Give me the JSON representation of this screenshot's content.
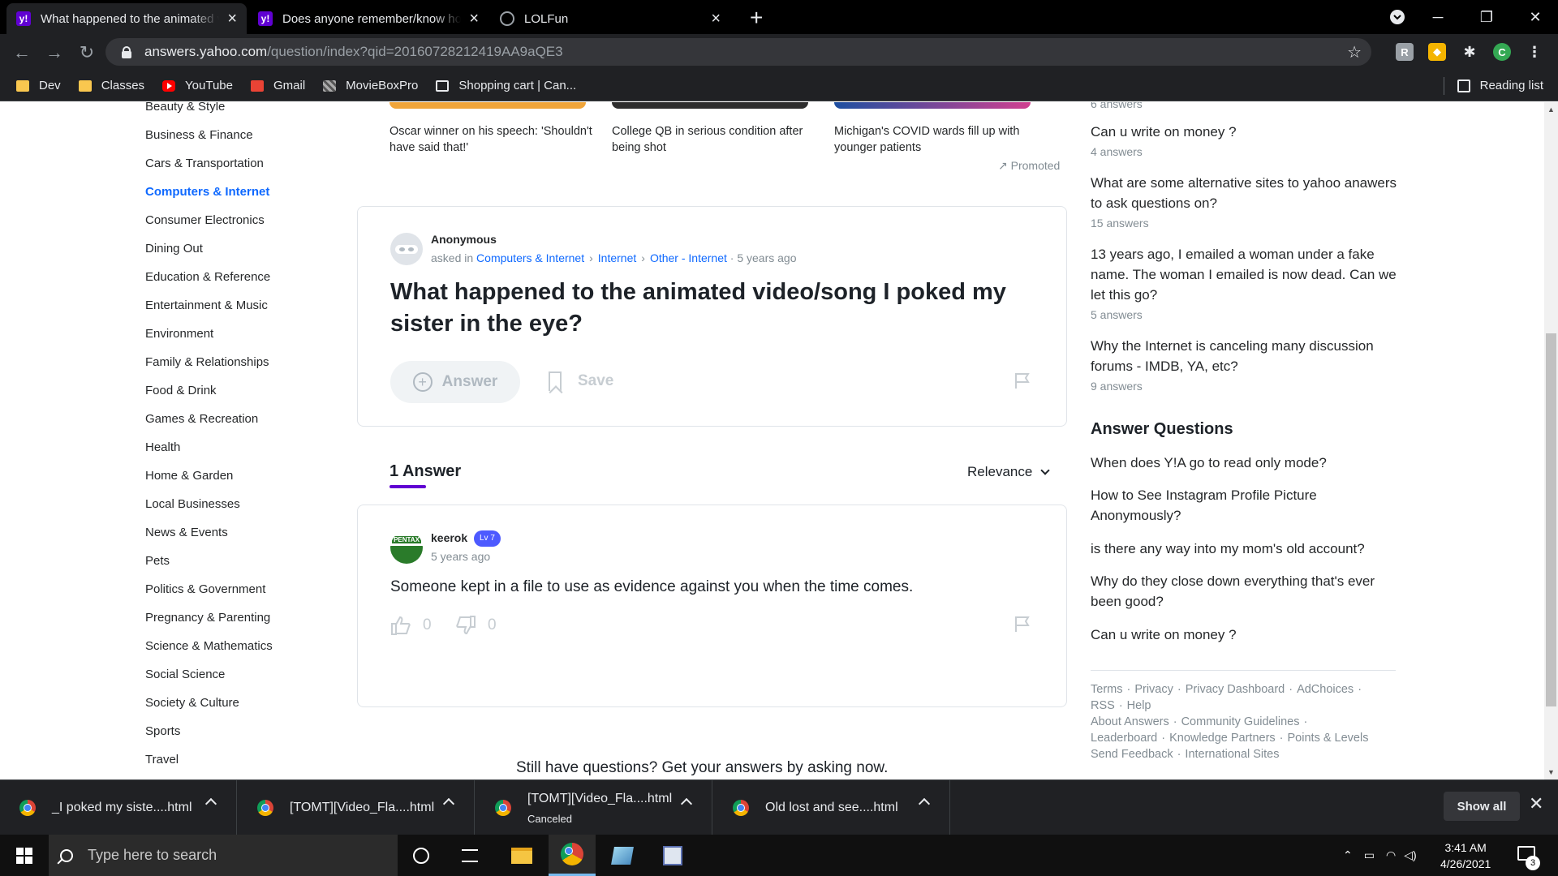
{
  "browser": {
    "tabs": [
      {
        "title": "What happened to the animated video/song I poked my sister in the eye? - Yahoo Answers",
        "favicon": "yahoo-icon",
        "active": true
      },
      {
        "title": "Does anyone remember/know how to find an old video?",
        "favicon": "yahoo-icon",
        "active": false
      },
      {
        "title": "LOLFun",
        "favicon": "globe-icon",
        "active": false
      }
    ],
    "url_host": "answers.yahoo.com",
    "url_path": "/question/index?qid=20160728212419AA9aQE3",
    "profile_initial": "C",
    "bookmarks": [
      {
        "label": "Dev",
        "icon": "folder-icon"
      },
      {
        "label": "Classes",
        "icon": "folder-icon"
      },
      {
        "label": "YouTube",
        "icon": "youtube-icon"
      },
      {
        "label": "Gmail",
        "icon": "gmail-icon"
      },
      {
        "label": "MovieBoxPro",
        "icon": "moviebox-icon"
      },
      {
        "label": "Shopping cart | Can...",
        "icon": "cart-icon"
      }
    ],
    "reading_list": "Reading list"
  },
  "sidebar": {
    "categories": [
      {
        "label": "Beauty & Style",
        "active": false
      },
      {
        "label": "Business & Finance",
        "active": false
      },
      {
        "label": "Cars & Transportation",
        "active": false
      },
      {
        "label": "Computers & Internet",
        "active": true
      },
      {
        "label": "Consumer Electronics",
        "active": false
      },
      {
        "label": "Dining Out",
        "active": false
      },
      {
        "label": "Education & Reference",
        "active": false
      },
      {
        "label": "Entertainment & Music",
        "active": false
      },
      {
        "label": "Environment",
        "active": false
      },
      {
        "label": "Family & Relationships",
        "active": false
      },
      {
        "label": "Food & Drink",
        "active": false
      },
      {
        "label": "Games & Recreation",
        "active": false
      },
      {
        "label": "Health",
        "active": false
      },
      {
        "label": "Home & Garden",
        "active": false
      },
      {
        "label": "Local Businesses",
        "active": false
      },
      {
        "label": "News & Events",
        "active": false
      },
      {
        "label": "Pets",
        "active": false
      },
      {
        "label": "Politics & Government",
        "active": false
      },
      {
        "label": "Pregnancy & Parenting",
        "active": false
      },
      {
        "label": "Science & Mathematics",
        "active": false
      },
      {
        "label": "Social Science",
        "active": false
      },
      {
        "label": "Society & Culture",
        "active": false
      },
      {
        "label": "Sports",
        "active": false
      },
      {
        "label": "Travel",
        "active": false
      }
    ]
  },
  "promo": {
    "items": [
      {
        "caption": "Oscar winner on his speech: 'Shouldn't have said that!'"
      },
      {
        "caption": "College QB in serious condition after being shot"
      },
      {
        "caption": "Michigan's COVID wards fill up with younger patients"
      }
    ],
    "promoted_label": "Promoted"
  },
  "question": {
    "author": "Anonymous",
    "asked_in": "asked in",
    "breadcrumb": [
      "Computers & Internet",
      "Internet",
      "Other - Internet"
    ],
    "time": "5 years ago",
    "title": "What happened to the animated video/song I poked my sister in the eye?",
    "answer_label": "Answer",
    "save_label": "Save"
  },
  "answers_header": {
    "count_label": "1 Answer",
    "sort_label": "Relevance"
  },
  "answer": {
    "author": "keerok",
    "level": "Lv 7",
    "avatar_text": "PENTAX",
    "time": "5 years ago",
    "text": "Someone kept in a file to use as evidence against you when the time comes.",
    "upvotes": "0",
    "downvotes": "0"
  },
  "still_questions": "Still have questions? Get your answers by asking now.",
  "related": [
    {
      "question": "6 answers",
      "count": ""
    },
    {
      "question": "Can u write on money ?",
      "count": "4 answers"
    },
    {
      "question": "What are some alternative sites to yahoo anawers to ask questions on?",
      "count": "15 answers"
    },
    {
      "question": "13 years ago, I emailed a woman under a fake name. The woman I emailed is now dead. Can we let this go?",
      "count": "5 answers"
    },
    {
      "question": "Why the Internet is canceling many discussion forums - IMDB, YA, etc?",
      "count": "9 answers"
    }
  ],
  "answer_questions": {
    "heading": "Answer Questions",
    "items": [
      "When does Y!A go to read only mode?",
      "How to See Instagram Profile Picture Anonymously?",
      "is there any way into my mom's old account?",
      "Why do they close down everything that's ever been good?",
      "Can u write on money ?"
    ]
  },
  "footer": {
    "links": [
      "Terms",
      "Privacy",
      "Privacy Dashboard",
      "AdChoices",
      "RSS",
      "Help",
      "About Answers",
      "Community Guidelines",
      "Leaderboard",
      "Knowledge Partners",
      "Points & Levels",
      "Send Feedback",
      "International Sites"
    ]
  },
  "downloads": {
    "items": [
      {
        "name": "_I poked my siste....html",
        "status": ""
      },
      {
        "name": "[TOMT][Video_Fla....html",
        "status": ""
      },
      {
        "name": "[TOMT][Video_Fla....html",
        "status": "Canceled"
      },
      {
        "name": "Old lost and see....html",
        "status": ""
      }
    ],
    "show_all": "Show all"
  },
  "taskbar": {
    "search_placeholder": "Type here to search",
    "time": "3:41 AM",
    "date": "4/26/2021",
    "notifications": "3"
  },
  "colors": {
    "yahoo_purple": "#6001d2",
    "link_blue": "#0f69ff",
    "level_badge": "#4d5aff"
  }
}
